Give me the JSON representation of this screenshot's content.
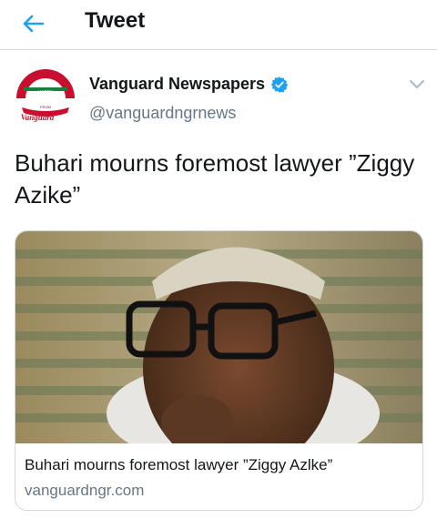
{
  "header": {
    "title": "Tweet",
    "back_icon": "arrow-left-icon",
    "accent": "#1da1f2"
  },
  "tweet": {
    "display_name": "Vanguard Newspapers",
    "handle": "@vanguardngrnews",
    "verified": true,
    "verified_icon": "verified-badge-icon",
    "menu_icon": "chevron-down-icon",
    "text": "Buhari mourns foremost lawyer ”Ziggy Azike”",
    "avatar_lines": [
      "HAPPY",
      "INDEPENDENCE",
      "DAY",
      "FROM",
      "Vanguard"
    ]
  },
  "card": {
    "title": "Buhari mourns foremost lawyer ”Ziggy Azlke”",
    "domain": "vanguardngr.com"
  }
}
